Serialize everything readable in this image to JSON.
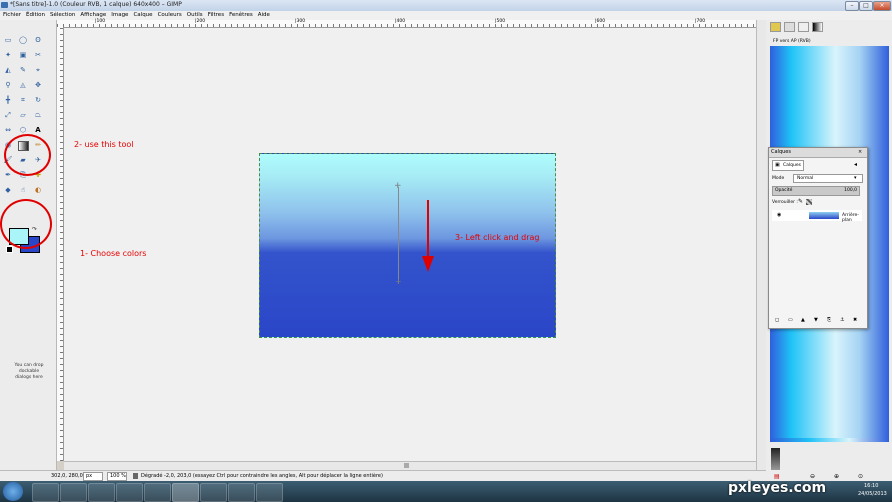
{
  "window": {
    "title": "*[Sans titre]-1.0 (Couleur RVB, 1 calque) 640x400 – GIMP"
  },
  "menu": [
    "Fichier",
    "Édition",
    "Sélection",
    "Affichage",
    "Image",
    "Calque",
    "Couleurs",
    "Outils",
    "Filtres",
    "Fenêtres",
    "Aide"
  ],
  "toolbox": {
    "drop_hint": "You can drop dockable dialogs here",
    "fg_color": "#a9f5f7",
    "bg_color": "#2a46c8"
  },
  "annotations": {
    "step1": "1- Choose colors",
    "step2": "2- use this tool",
    "step3": "3- Left click and drag",
    "color": "#e60000"
  },
  "ruler": {
    "ticks": [
      "|100",
      "|200",
      "|300",
      "|400",
      "|500",
      "|600",
      "|700"
    ]
  },
  "status": {
    "coords": "302,0, 280,0",
    "unit": "px",
    "zoom": "100 %",
    "message": "Dégradé -2,0, 203,0 (essayez Ctrl pour contraindre les angles, Alt pour déplacer la ligne entière)"
  },
  "right_dock": {
    "gradient_name": "FP vers AP (RVB)"
  },
  "layers": {
    "title": "Calques",
    "tab": "Calques",
    "mode_label": "Mode",
    "mode_value": "Normal",
    "opacity_label": "Opacité",
    "opacity_value": "100,0",
    "lock_label": "Verrouiller :",
    "layer_name": "Arrière-plan"
  },
  "taskbar": {
    "time": "16:10",
    "date": "24/05/2013"
  },
  "watermark": "pxleyes.com"
}
